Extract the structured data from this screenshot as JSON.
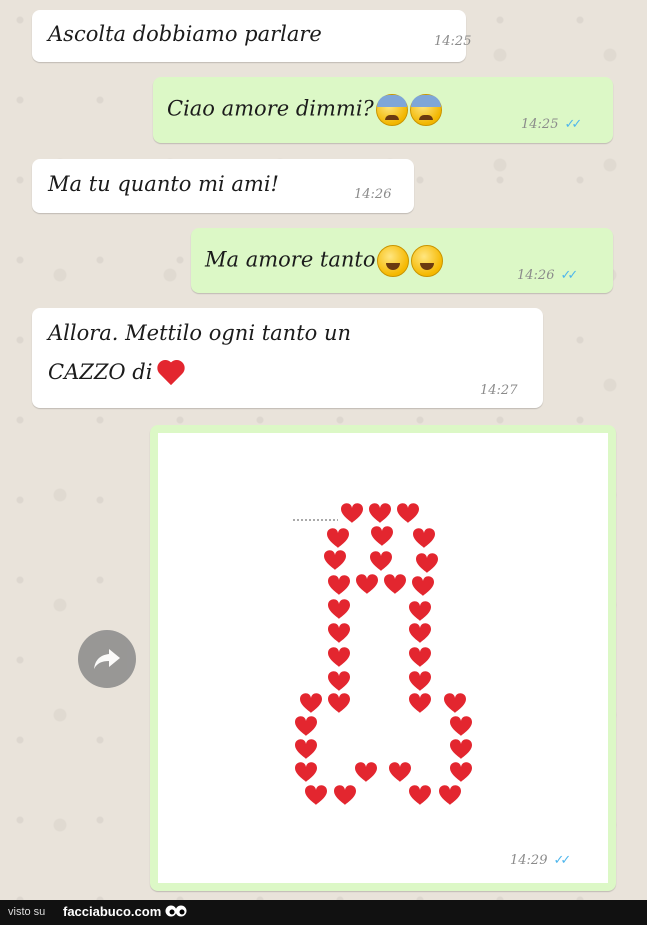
{
  "messages": [
    {
      "direction": "in",
      "text": "Ascolta dobbiamo parlare",
      "time": "14:25"
    },
    {
      "direction": "out",
      "text": "Ciao amore dimmi?",
      "emoji": [
        "fearful-face",
        "fearful-face"
      ],
      "time": "14:25",
      "ticks": "✓✓"
    },
    {
      "direction": "in",
      "text": "Ma tu quanto mi ami!",
      "time": "14:26"
    },
    {
      "direction": "out",
      "text": "Ma amore tanto",
      "emoji": [
        "sweat-smile-face",
        "sweat-smile-face"
      ],
      "time": "14:26",
      "ticks": "✓✓"
    },
    {
      "direction": "in",
      "text_line1": "Allora. Mettilo ogni tanto un",
      "text_line2": "CAZZO di",
      "emoji": [
        "red-heart"
      ],
      "time": "14:27"
    }
  ],
  "image_message": {
    "direction": "out",
    "content": "heart-shape-drawing",
    "time": "14:29",
    "ticks": "✓✓"
  },
  "forward_button": {
    "icon": "share-arrow-icon"
  },
  "footer": {
    "prefix": "visto su",
    "site": "facciabuco.com"
  },
  "colors": {
    "incoming": "#ffffff",
    "outgoing": "#dcf8c6",
    "heart": "#e3262f",
    "ticks": "#4fb6ec",
    "wallpaper": "#ece5dd"
  }
}
